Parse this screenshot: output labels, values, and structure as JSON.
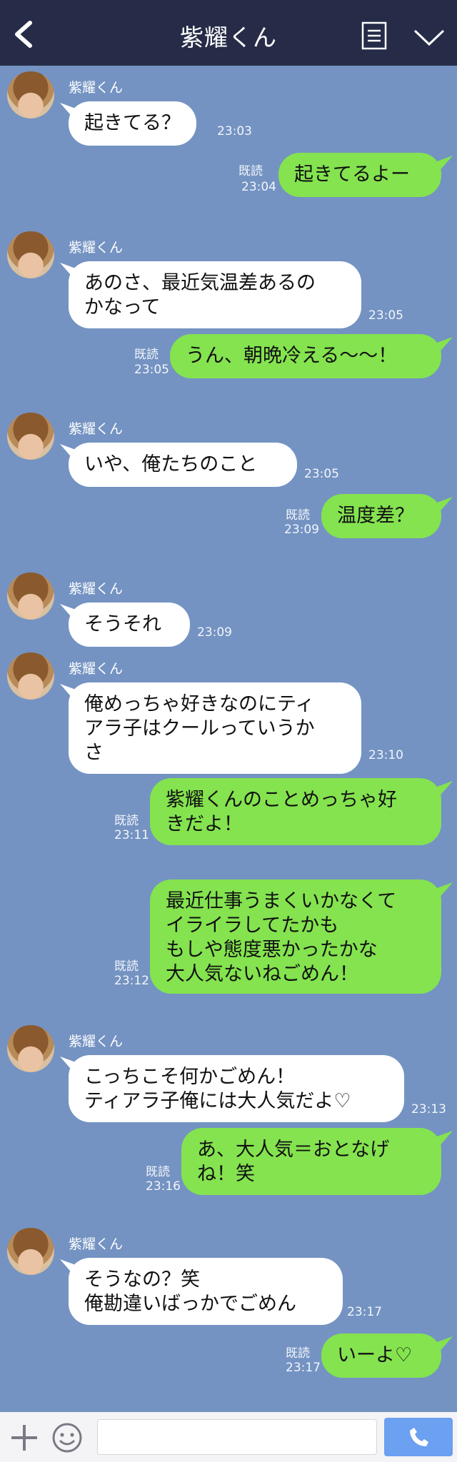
{
  "header": {
    "title": "紫耀くん"
  },
  "sender_name": "紫耀くん",
  "read_label": "既読",
  "messages": [
    {
      "dir": "in",
      "text": "起きてる？",
      "time": "23:03"
    },
    {
      "dir": "out",
      "text": "起きてるよー",
      "time": "23:04"
    },
    {
      "dir": "in",
      "text": "あのさ、最近気温差あるの\nかなって",
      "time": "23:05"
    },
    {
      "dir": "out",
      "text": "うん、朝晩冷える〜〜！",
      "time": "23:05"
    },
    {
      "dir": "in",
      "text": "いや、俺たちのこと",
      "time": "23:05"
    },
    {
      "dir": "out",
      "text": "温度差？",
      "time": "23:09"
    },
    {
      "dir": "in",
      "text": "そうそれ",
      "time": "23:09"
    },
    {
      "dir": "in",
      "text": "俺めっちゃ好きなのにティ\nアラ子はクールっていうか\nさ",
      "time": "23:10"
    },
    {
      "dir": "out",
      "text": "紫耀くんのことめっちゃ好\nきだよ！",
      "time": "23:11"
    },
    {
      "dir": "out",
      "text": "最近仕事うまくいかなくて\nイライラしてたかも\nもしや態度悪かったかな\n大人気ないねごめん！",
      "time": "23:12"
    },
    {
      "dir": "in",
      "text": "こっちこそ何かごめん！\nティアラ子俺には大人気だよ♡",
      "time": "23:13"
    },
    {
      "dir": "out",
      "text": "あ、大人気＝おとなげ\nね！笑",
      "time": "23:16"
    },
    {
      "dir": "in",
      "text": "そうなの？笑\n俺勘違いばっかでごめん",
      "time": "23:17"
    },
    {
      "dir": "out",
      "text": "いーよ♡",
      "time": "23:17"
    }
  ],
  "icons": {
    "back": "chevron-left-icon",
    "menu": "menu-list-icon",
    "collapse": "chevron-down-icon",
    "add": "plus-icon",
    "sticker": "smile-icon",
    "call": "phone-icon"
  },
  "colors": {
    "background": "#7493c2",
    "header": "#262c48",
    "bubble_in": "#ffffff",
    "bubble_out": "#84e34f",
    "call_button": "#6ca0f0"
  }
}
